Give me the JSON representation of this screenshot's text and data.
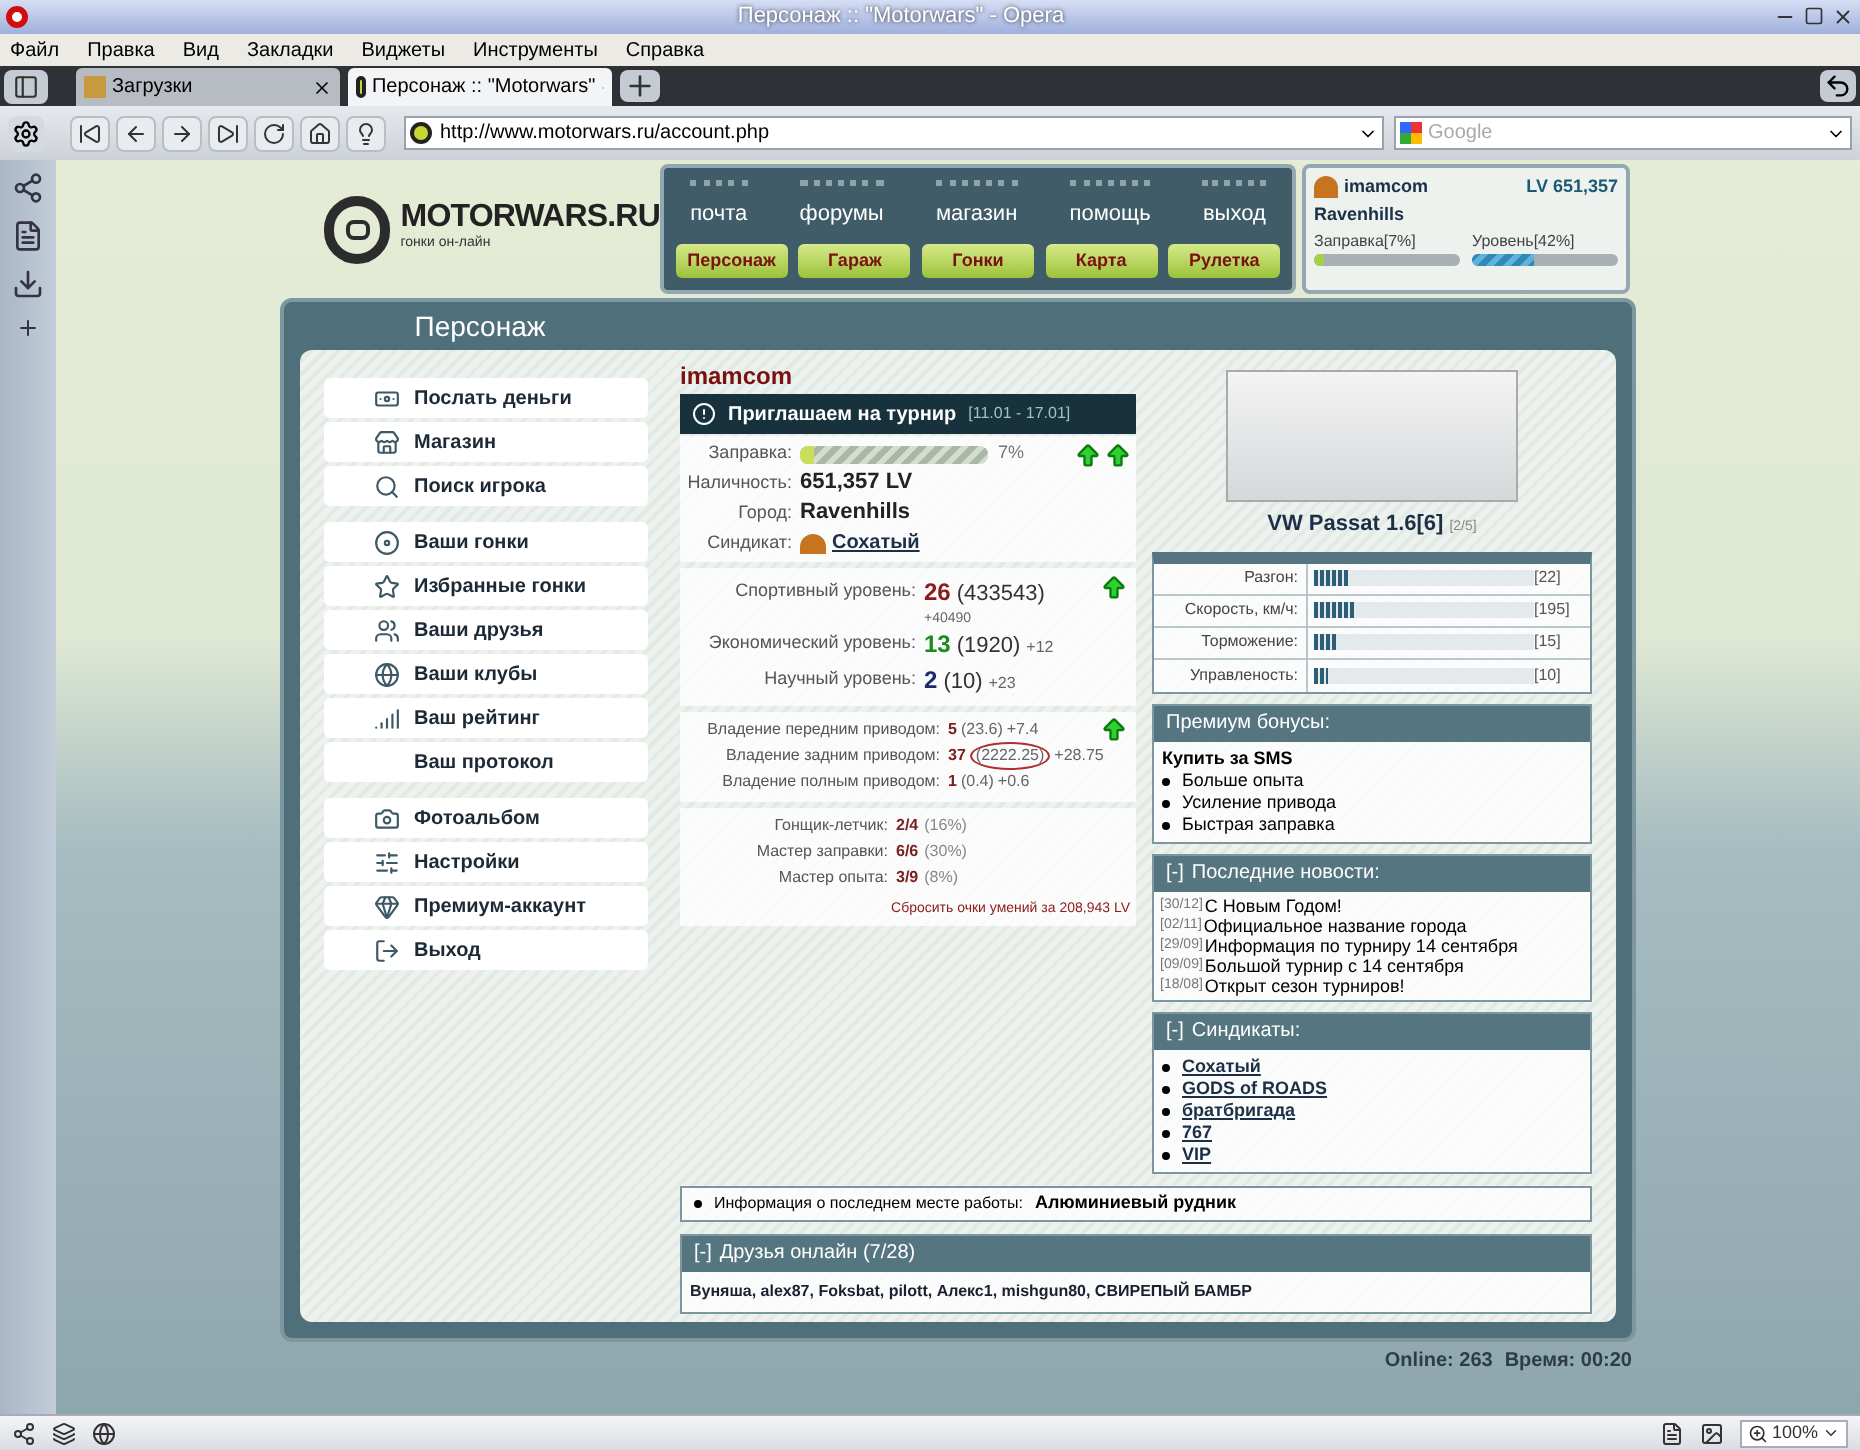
{
  "browser": {
    "title": "Персонаж :: \"Motorwars\" - Opera",
    "menu": [
      "Файл",
      "Правка",
      "Вид",
      "Закладки",
      "Виджеты",
      "Инструменты",
      "Справка"
    ],
    "tabs": [
      {
        "label": "Загрузки",
        "selected": false
      },
      {
        "label": "Персонаж :: \"Motorwars\"",
        "selected": true
      }
    ],
    "address": "http://www.motorwars.ru/account.php",
    "search_placeholder": "Google",
    "zoom": "100%"
  },
  "site": {
    "logo": {
      "name": "MOTORWARS.RU",
      "tagline": "гонки он-лайн"
    },
    "nav_links": [
      "почта",
      "форумы",
      "магазин",
      "помощь",
      "выход"
    ],
    "nav_buttons": [
      "Персонаж",
      "Гараж",
      "Гонки",
      "Карта",
      "Рулетка"
    ],
    "user": {
      "name": "imamcom",
      "money": "LV 651,357",
      "city": "Ravenhills",
      "bars": [
        {
          "label": "Заправка[7%]",
          "level": 0.07
        },
        {
          "label": "Уровень[42%]",
          "level": 0.42
        }
      ]
    },
    "panel_title": "Персонаж",
    "sidebar": [
      [
        {
          "label": "Послать деньги",
          "icon": true
        },
        {
          "label": "Магазин",
          "icon": true
        },
        {
          "label": "Поиск игрока",
          "icon": true
        }
      ],
      [
        {
          "label": "Ваши гонки",
          "icon": true
        },
        {
          "label": "Избранные гонки",
          "icon": true
        },
        {
          "label": "Ваши друзья",
          "icon": true
        },
        {
          "label": "Ваши клубы",
          "icon": true
        },
        {
          "label": "Ваш рейтинг",
          "icon": true
        },
        {
          "label": "Ваш протокол",
          "icon": false
        }
      ],
      [
        {
          "label": "Фотоальбом",
          "icon": true
        },
        {
          "label": "Настройки",
          "icon": true
        },
        {
          "label": "Премиум-аккаунт",
          "icon": true
        },
        {
          "label": "Выход",
          "icon": true
        }
      ]
    ],
    "player": "imamcom",
    "tournament": {
      "title": "Приглашаем на турнир",
      "dates": "[11.01 - 17.01]"
    },
    "profile": {
      "fuel": {
        "label": "Заправка:",
        "level": 0.07,
        "reading": "7%"
      },
      "arrows": true,
      "rows": [
        {
          "label": "Наличность:",
          "value": "651,357 LV"
        },
        {
          "label": "Город:",
          "value": "Ravenhills"
        }
      ],
      "syndicate": {
        "label": "Синдикат:",
        "value": "Сохатый"
      }
    },
    "levels": [
      {
        "label": "Спортивный уровень:",
        "value": "26",
        "detail": "(433543)",
        "bonus": "+40490",
        "color": "#8b1a1a",
        "arrow": true
      },
      {
        "label": "Экономический уровень:",
        "value": "13",
        "detail": "(1920)",
        "bonus": "+12",
        "color": "#1f8a1f",
        "arrow": false
      },
      {
        "label": "Научный уровень:",
        "value": "2",
        "detail": "(10)",
        "bonus": "+23",
        "color": "#1a2a6b",
        "arrow": false
      }
    ],
    "drives": [
      {
        "label": "Владение передним приводом:",
        "value": "5",
        "detail": "(23.6)",
        "bonus": "+7.4",
        "arrow": true,
        "circled": false
      },
      {
        "label": "Владение задним приводом:",
        "value": "37",
        "detail": "(2222.25)",
        "bonus": "+28.75",
        "arrow": false,
        "circled": true
      },
      {
        "label": "Владение полным приводом:",
        "value": "1",
        "detail": "(0.4)",
        "bonus": "+0.6",
        "arrow": false,
        "circled": false
      }
    ],
    "skills": [
      {
        "label": "Гонщик-летчик:",
        "value": "2/4",
        "detail": "(16%)"
      },
      {
        "label": "Мастер заправки:",
        "value": "6/6",
        "detail": "(30%)"
      },
      {
        "label": "Мастер опыта:",
        "value": "3/9",
        "detail": "(8%)"
      }
    ],
    "reset_link": "Сбросить очки умений за 208,943 LV",
    "car": {
      "name": "VW Passat 1.6[6]",
      "slots": "[2/5]",
      "stats": [
        {
          "label": "Разгон:",
          "level": 0.16,
          "reading": "[22]"
        },
        {
          "label": "Скорость, км/ч:",
          "level": 0.19,
          "reading": "[195]"
        },
        {
          "label": "Торможение:",
          "level": 0.11,
          "reading": "[15]"
        },
        {
          "label": "Управленость:",
          "level": 0.06,
          "reading": "[10]"
        }
      ]
    },
    "premium": {
      "title": "Премиум бонусы:",
      "heading": "Купить за SMS",
      "items": [
        "Больше опыта",
        "Усиление привода",
        "Быстрая заправка"
      ]
    },
    "news": {
      "toggle": "[-]",
      "title": "Последние новости:",
      "items": [
        {
          "date": "[30/12]",
          "text": "С Новым Годом!"
        },
        {
          "date": "[02/11]",
          "text": "Официальное название города"
        },
        {
          "date": "[29/09]",
          "text": "Информация по турниру 14 сентября"
        },
        {
          "date": "[09/09]",
          "text": "Большой турнир с 14 сентября"
        },
        {
          "date": "[18/08]",
          "text": "Открыт сезон турниров!"
        }
      ]
    },
    "syndicates": {
      "toggle": "[-]",
      "title": "Синдикаты:",
      "items": [
        "Сохатый",
        "GODS of ROADS",
        "братбригада",
        "767",
        "VIP"
      ]
    },
    "work": {
      "label": "Информация о последнем месте работы:",
      "value": "Алюминиевый рудник"
    },
    "friends": {
      "toggle": "[-]",
      "title": "Друзья онлайн (7/28)",
      "list": "Вуняша, alex87, Foksbat, pilott, Алекс1, mishgun80, СВИРЕПЫЙ БАМБР"
    },
    "footer": {
      "online": "Online: 263",
      "time": "Время: 00:20"
    }
  }
}
